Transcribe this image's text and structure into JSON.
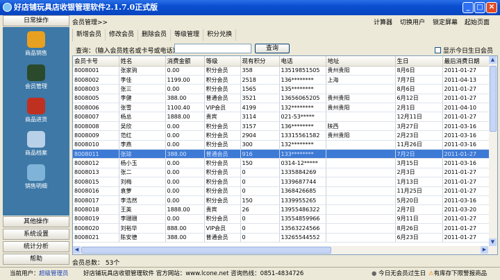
{
  "window": {
    "title": "好店铺玩具店收银管理软件2.1.7.0正式版"
  },
  "sidebar": {
    "top": "日常操作",
    "items": [
      {
        "label": "商品销售",
        "icon": "shopping-cart-icon",
        "color": "#e8a020"
      },
      {
        "label": "会员管理",
        "icon": "members-icon",
        "color": "#2b4a2b"
      },
      {
        "label": "商品进货",
        "icon": "globe-arrow-icon",
        "color": "#c03020"
      },
      {
        "label": "商品档案",
        "icon": "magnifier-icon",
        "color": "#b8d0e8"
      },
      {
        "label": "销售明细",
        "icon": "box-books-icon",
        "color": "#7fb3d8"
      }
    ],
    "bottom": [
      "其他操作",
      "系统设置",
      "统计分析",
      "帮助"
    ]
  },
  "main": {
    "breadcrumb": "会员管理>>",
    "toolbar": [
      "计算器",
      "切换用户",
      "锁定屏幕",
      "起始页面"
    ],
    "tabs": [
      "新增会员",
      "修改会员",
      "删除会员",
      "等级管理",
      "积分兑换"
    ],
    "query_label": "查询：（输入会员姓名或卡号或电话）",
    "query_value": "",
    "query_button": "查询",
    "birthday_checkbox": "显示今日生日会员",
    "birthday_checked": false,
    "columns": [
      "会员卡号",
      "姓名",
      "消费金额",
      "等级",
      "现有积分",
      "电话",
      "地址",
      "生日",
      "最后消费日期"
    ],
    "rows": [
      [
        "8008001",
        "张家驹",
        "0.00",
        "积分会员",
        "358",
        "13519851505",
        "贵州贵阳",
        "8月6日",
        "2011-01-27"
      ],
      [
        "8008002",
        "李佳",
        "1199.00",
        "积分会员",
        "2518",
        "136********",
        "上海",
        "7月7日",
        "2011-04-13"
      ],
      [
        "8008003",
        "张三",
        "0.00",
        "积分会员",
        "1565",
        "135********",
        "",
        "8月6日",
        "2011-01-27"
      ],
      [
        "8008005",
        "李健",
        "388.00",
        "普通会员",
        "3521",
        "13656065205",
        "贵州贵阳",
        "6月12日",
        "2011-01-27"
      ],
      [
        "8008006",
        "张雪",
        "1100.40",
        "VIP会员",
        "4199",
        "132********",
        "贵州贵阳",
        "2月1日",
        "2011-04-10"
      ],
      [
        "8008007",
        "杨总",
        "1888.00",
        "贵宾",
        "3114",
        "021-53*****",
        "",
        "12月11日",
        "2011-01-27"
      ],
      [
        "8008008",
        "吴欣",
        "0.00",
        "积分会员",
        "3157",
        "136********",
        "陕西",
        "3月27日",
        "2011-03-16"
      ],
      [
        "8008009",
        "范红",
        "0.00",
        "积分会员",
        "2904",
        "13315561582",
        "贵州贵阳",
        "2月23日",
        "2011-03-16"
      ],
      [
        "8008010",
        "李燕",
        "0.00",
        "积分会员",
        "300",
        "132********",
        "",
        "11月26日",
        "2011-03-16"
      ],
      [
        "8008011",
        "张琼",
        "388.00",
        "普通会员",
        "916",
        "133********",
        "",
        "7月2日",
        "2011-01-27"
      ],
      [
        "8008012",
        "杨小玉",
        "0.00",
        "积分会员",
        "150",
        "0314-12*****",
        "",
        "3月15日",
        "2011-03-16"
      ],
      [
        "8008013",
        "张二",
        "0.00",
        "积分会员",
        "0",
        "1335884269",
        "",
        "2月3日",
        "2011-01-27"
      ],
      [
        "8008015",
        "刘梅",
        "0.00",
        "积分会员",
        "0",
        "1339687744",
        "",
        "1月13日",
        "2011-01-27"
      ],
      [
        "8008016",
        "袁萝",
        "0.00",
        "积分会员",
        "0",
        "1368426685",
        "",
        "11月25日",
        "2011-01-27"
      ],
      [
        "8008017",
        "李浩然",
        "0.00",
        "积分会员",
        "150",
        "1339955265",
        "",
        "5月20日",
        "2011-03-16"
      ],
      [
        "8008018",
        "王英",
        "1888.00",
        "贵宾",
        "26",
        "13955486322",
        "",
        "2月7日",
        "2011-03-20"
      ],
      [
        "8008019",
        "李珊珊",
        "0.00",
        "积分会员",
        "0",
        "13554859966",
        "",
        "9月11日",
        "2011-01-27"
      ],
      [
        "8008020",
        "刘裕华",
        "888.00",
        "VIP会员",
        "0",
        "13563224566",
        "",
        "8月26日",
        "2011-01-27"
      ],
      [
        "8008021",
        "陈安德",
        "388.00",
        "普通会员",
        "0",
        "13265544552",
        "",
        "6月23日",
        "2011-01-27"
      ]
    ],
    "selected_row": 9,
    "total": "会员总数： 53个"
  },
  "status": {
    "user_label": "当前用户：",
    "user": "超级管理员",
    "info": "好店铺玩具店收银管理软件 官方网站：www.lcone.net  咨询热线：0851-4834726",
    "birthday": "今日无会员过生日",
    "stock": "有库存下限警报商品"
  },
  "colors": {
    "title": "#0a4fd0",
    "panel": "#3d78a6",
    "selected": "#3d7ad5"
  }
}
